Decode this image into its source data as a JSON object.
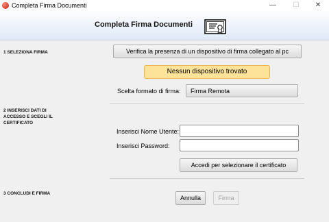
{
  "window": {
    "title": "Completa Firma Documenti",
    "minimize": "—",
    "maximize": "☐",
    "close": "✕"
  },
  "header": {
    "title": "Completa Firma Documenti",
    "icon": "certificate-icon"
  },
  "step1": {
    "label": "1 SELEZIONA FIRMA",
    "verify_button": "Verifica la presenza di un dispositivo di firma collegato al pc",
    "status": "Nessun dispositivo trovato",
    "format_label": "Scelta formato di firma:",
    "format_value": "Firma Remota"
  },
  "step2": {
    "label": "2 INSERISCI DATI DI ACCESSO E SCEGLI IL CERTIFICATO",
    "username_label": "Inserisci Nome Utente:",
    "username_value": "",
    "password_label": "Inserisci Password:",
    "password_value": "",
    "access_button": "Accedi per selezionare il certificato"
  },
  "step3": {
    "label": "3 CONCLUDI E FIRMA",
    "cancel_button": "Annulla",
    "sign_button": "Firma"
  },
  "colors": {
    "status_bg": "#fde39a",
    "status_border": "#e8b64c"
  }
}
